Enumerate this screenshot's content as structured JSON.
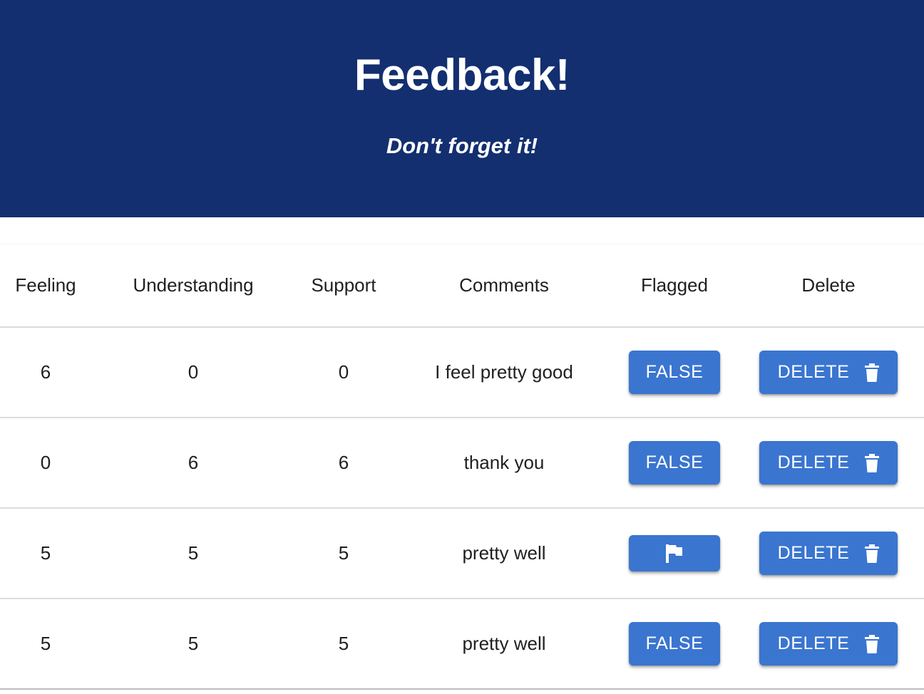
{
  "header": {
    "title": "Feedback!",
    "subtitle": "Don't forget it!",
    "background": "#132f70"
  },
  "table": {
    "columns": [
      "Feeling",
      "Understanding",
      "Support",
      "Comments",
      "Flagged",
      "Delete"
    ],
    "rows": [
      {
        "feeling": "6",
        "understanding": "0",
        "support": "0",
        "comments": "I feel pretty good",
        "flagged": false,
        "flag_label": "FALSE",
        "delete_label": "DELETE"
      },
      {
        "feeling": "0",
        "understanding": "6",
        "support": "6",
        "comments": "thank you",
        "flagged": false,
        "flag_label": "FALSE",
        "delete_label": "DELETE"
      },
      {
        "feeling": "5",
        "understanding": "5",
        "support": "5",
        "comments": "pretty well",
        "flagged": true,
        "flag_icon": "flag-icon",
        "delete_label": "DELETE"
      },
      {
        "feeling": "5",
        "understanding": "5",
        "support": "5",
        "comments": "pretty well",
        "flagged": false,
        "flag_label": "FALSE",
        "delete_label": "DELETE"
      }
    ]
  },
  "colors": {
    "button": "#3a75d0",
    "header_bg": "#132f70"
  }
}
